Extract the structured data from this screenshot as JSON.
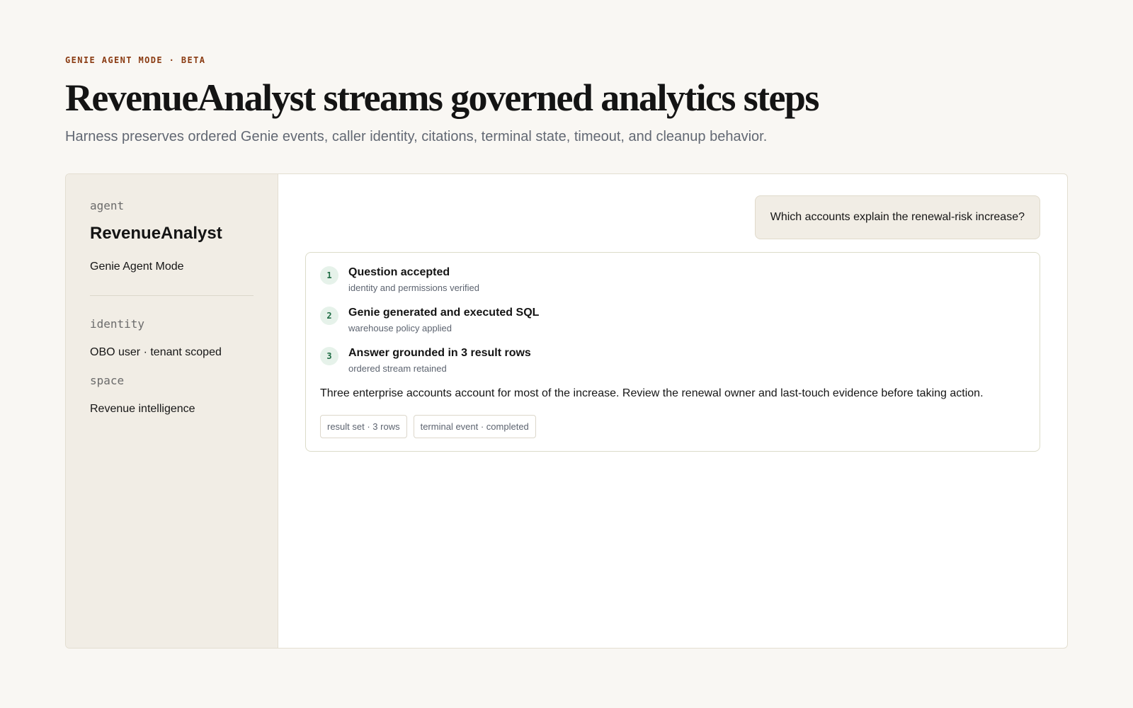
{
  "header": {
    "eyebrow": "GENIE AGENT MODE · BETA",
    "title": "RevenueAnalyst streams governed analytics steps",
    "subtitle": "Harness preserves ordered Genie events, caller identity, citations, terminal state, timeout, and cleanup behavior."
  },
  "sidebar": {
    "agent_label": "agent",
    "agent_name": "RevenueAnalyst",
    "mode": "Genie Agent Mode",
    "identity_label": "identity",
    "identity_value": "OBO user · tenant scoped",
    "space_label": "space",
    "space_value": "Revenue intelligence"
  },
  "conversation": {
    "question": "Which accounts explain the renewal-risk increase?",
    "steps": [
      {
        "number": "1",
        "title": "Question accepted",
        "detail": "identity and permissions verified"
      },
      {
        "number": "2",
        "title": "Genie generated and executed SQL",
        "detail": "warehouse policy applied"
      },
      {
        "number": "3",
        "title": "Answer grounded in 3 result rows",
        "detail": "ordered stream retained"
      }
    ],
    "answer": "Three enterprise accounts account for most of the increase. Review the renewal owner and last-touch evidence before taking action.",
    "chips": [
      "result set · 3 rows",
      "terminal event · completed"
    ]
  },
  "colors": {
    "background": "#f9f7f3",
    "accent": "#8a3b12",
    "step_badge": "#e6f2ea",
    "step_badge_text": "#1e6b43",
    "sidebar_bg": "#f1ede5"
  }
}
